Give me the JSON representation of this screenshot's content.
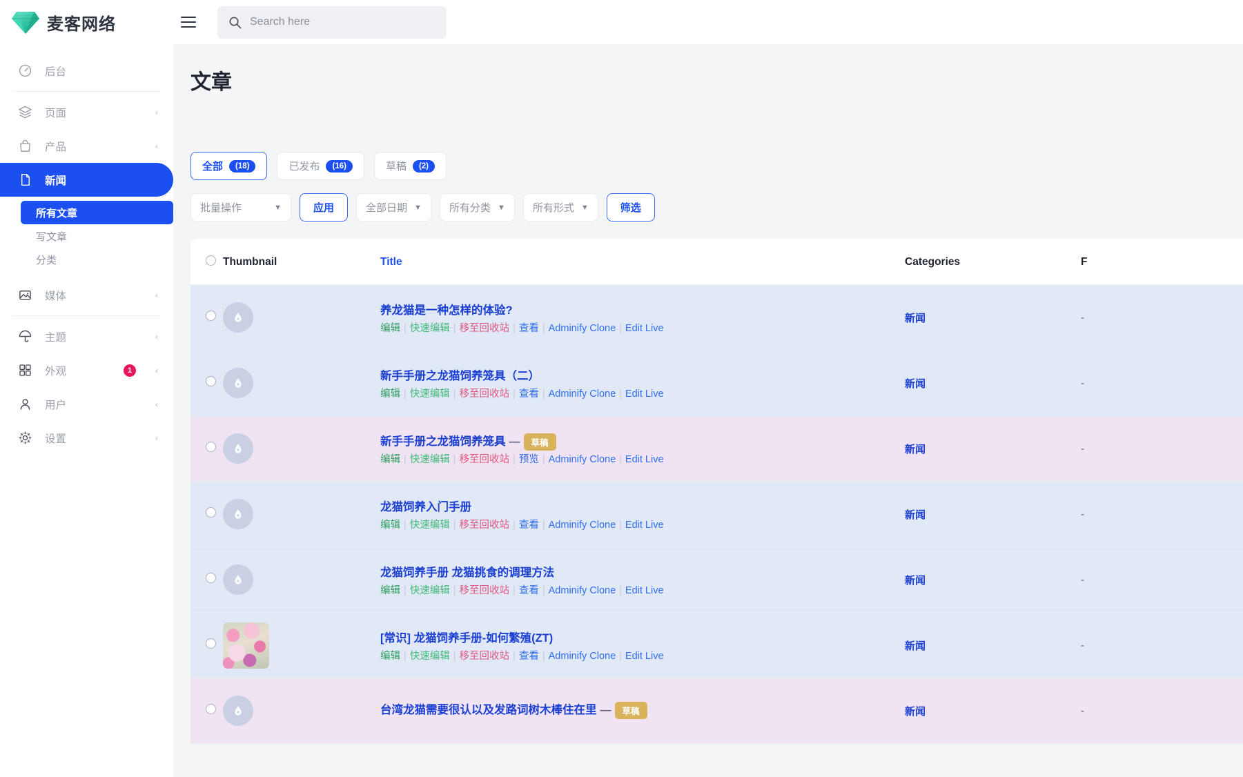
{
  "brand": {
    "name": "麦客网络",
    "logo_icon": "diamond-icon"
  },
  "topbar": {
    "menu_icon": "hamburger-icon",
    "search": {
      "icon": "search-icon",
      "placeholder": "Search here",
      "value": ""
    }
  },
  "sidebar": {
    "items": [
      {
        "label": "后台",
        "icon": "dashboard-icon",
        "chevron": "",
        "badge": "",
        "active": false
      },
      {
        "label": "页面",
        "icon": "layers-icon",
        "chevron": "‹",
        "badge": "",
        "active": false
      },
      {
        "label": "产品",
        "icon": "bag-icon",
        "chevron": "‹",
        "badge": "",
        "active": false
      },
      {
        "label": "新闻",
        "icon": "file-icon",
        "chevron": "",
        "badge": "",
        "active": true
      },
      {
        "label": "媒体",
        "icon": "image-icon",
        "chevron": "‹",
        "badge": "",
        "active": false
      },
      {
        "label": "主题",
        "icon": "umbrella-icon",
        "chevron": "‹",
        "badge": "",
        "active": false
      },
      {
        "label": "外观",
        "icon": "grid-icon",
        "chevron": "‹",
        "badge": "1",
        "active": false
      },
      {
        "label": "用户",
        "icon": "user-icon",
        "chevron": "‹",
        "badge": "",
        "active": false
      },
      {
        "label": "设置",
        "icon": "gear-icon",
        "chevron": "‹",
        "badge": "",
        "active": false
      }
    ],
    "news_subitems": [
      {
        "label": "所有文章",
        "active": true
      },
      {
        "label": "写文章",
        "active": false
      },
      {
        "label": "分类",
        "active": false
      }
    ]
  },
  "page": {
    "title": "文章"
  },
  "tabs": [
    {
      "label": "全部",
      "count": "(18)",
      "active": true
    },
    {
      "label": "已发布",
      "count": "(16)",
      "active": false
    },
    {
      "label": "草稿",
      "count": "(2)",
      "active": false
    }
  ],
  "filters": {
    "bulk_action": "批量操作",
    "apply_label": "应用",
    "date": "全部日期",
    "category": "所有分类",
    "format": "所有形式",
    "filter_label": "筛选",
    "chevron_icon": "chevron-down-icon"
  },
  "table": {
    "headers": {
      "thumbnail": "Thumbnail",
      "title": "Title",
      "categories": "Categories",
      "last": "F"
    },
    "select_all_icon": "radio-unchecked-icon",
    "rows": [
      {
        "title": "养龙猫是一种怎样的体验?",
        "status": "published",
        "badge": "",
        "thumbnail": "placeholder",
        "category": "新闻",
        "last": "-",
        "actions": [
          {
            "label": "编辑",
            "cls": "a-edit"
          },
          {
            "label": "快速编辑",
            "cls": "a-quick"
          },
          {
            "label": "移至回收站",
            "cls": "a-trash"
          },
          {
            "label": "查看",
            "cls": "a-view"
          },
          {
            "label": "Adminify Clone",
            "cls": "a-blue"
          },
          {
            "label": "Edit Live",
            "cls": "a-blue"
          }
        ]
      },
      {
        "title": "新手手册之龙猫饲养笼具（二）",
        "status": "published",
        "badge": "",
        "thumbnail": "placeholder",
        "category": "新闻",
        "last": "-",
        "actions": [
          {
            "label": "编辑",
            "cls": "a-edit"
          },
          {
            "label": "快速编辑",
            "cls": "a-quick"
          },
          {
            "label": "移至回收站",
            "cls": "a-trash"
          },
          {
            "label": "查看",
            "cls": "a-view"
          },
          {
            "label": "Adminify Clone",
            "cls": "a-blue"
          },
          {
            "label": "Edit Live",
            "cls": "a-blue"
          }
        ]
      },
      {
        "title": "新手手册之龙猫饲养笼具",
        "status": "draft",
        "badge": "草稿",
        "thumbnail": "placeholder",
        "category": "新闻",
        "last": "-",
        "actions": [
          {
            "label": "编辑",
            "cls": "a-edit"
          },
          {
            "label": "快速编辑",
            "cls": "a-quick"
          },
          {
            "label": "移至回收站",
            "cls": "a-trash"
          },
          {
            "label": "预览",
            "cls": "a-view"
          },
          {
            "label": "Adminify Clone",
            "cls": "a-blue"
          },
          {
            "label": "Edit Live",
            "cls": "a-blue"
          }
        ]
      },
      {
        "title": "龙猫饲养入门手册",
        "status": "published",
        "badge": "",
        "thumbnail": "placeholder",
        "category": "新闻",
        "last": "-",
        "actions": [
          {
            "label": "编辑",
            "cls": "a-edit"
          },
          {
            "label": "快速编辑",
            "cls": "a-quick"
          },
          {
            "label": "移至回收站",
            "cls": "a-trash"
          },
          {
            "label": "查看",
            "cls": "a-view"
          },
          {
            "label": "Adminify Clone",
            "cls": "a-blue"
          },
          {
            "label": "Edit Live",
            "cls": "a-blue"
          }
        ]
      },
      {
        "title": "龙猫饲养手册 龙猫挑食的调理方法",
        "status": "published",
        "badge": "",
        "thumbnail": "placeholder",
        "category": "新闻",
        "last": "-",
        "actions": [
          {
            "label": "编辑",
            "cls": "a-edit"
          },
          {
            "label": "快速编辑",
            "cls": "a-quick"
          },
          {
            "label": "移至回收站",
            "cls": "a-trash"
          },
          {
            "label": "查看",
            "cls": "a-view"
          },
          {
            "label": "Adminify Clone",
            "cls": "a-blue"
          },
          {
            "label": "Edit Live",
            "cls": "a-blue"
          }
        ]
      },
      {
        "title": "[常识] 龙猫饲养手册-如何繁殖(ZT)",
        "status": "published",
        "badge": "",
        "thumbnail": "flowers",
        "category": "新闻",
        "last": "-",
        "actions": [
          {
            "label": "编辑",
            "cls": "a-edit"
          },
          {
            "label": "快速编辑",
            "cls": "a-quick"
          },
          {
            "label": "移至回收站",
            "cls": "a-trash"
          },
          {
            "label": "查看",
            "cls": "a-view"
          },
          {
            "label": "Adminify Clone",
            "cls": "a-blue"
          },
          {
            "label": "Edit Live",
            "cls": "a-blue"
          }
        ]
      },
      {
        "title": "台湾龙猫需要很认以及发路词树木棒住在里",
        "status": "draft",
        "badge": "草稿",
        "thumbnail": "placeholder",
        "category": "新闻",
        "last": "-",
        "actions": []
      }
    ]
  },
  "colors": {
    "accent_blue": "#1b4ff0",
    "brand_green": "#3ecfae",
    "badge_red": "#e8175d",
    "draft_gold": "#d9b35c",
    "row_published": "#e1e8f6",
    "row_draft": "#f0e4f3"
  }
}
